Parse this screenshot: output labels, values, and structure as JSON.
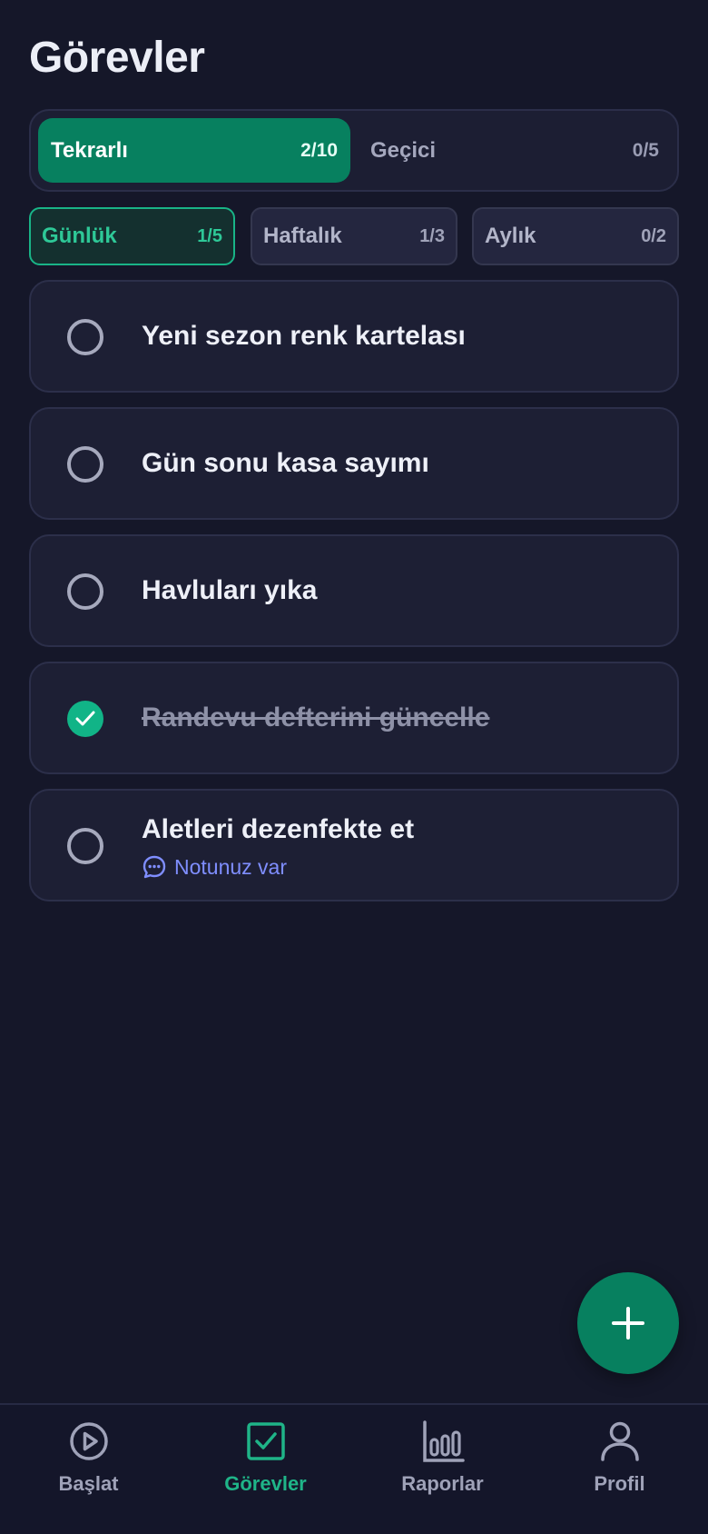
{
  "header": {
    "title": "Görevler"
  },
  "segment": {
    "active": {
      "label": "Tekrarlı",
      "count": "2/10"
    },
    "inactive": {
      "label": "Geçici",
      "count": "0/5"
    }
  },
  "periods": [
    {
      "label": "Günlük",
      "count": "1/5",
      "active": true
    },
    {
      "label": "Haftalık",
      "count": "1/3",
      "active": false
    },
    {
      "label": "Aylık",
      "count": "0/2",
      "active": false
    }
  ],
  "tasks": [
    {
      "title": "Yeni sezon renk kartelası",
      "done": false
    },
    {
      "title": "Gün sonu kasa sayımı",
      "done": false
    },
    {
      "title": "Havluları yıka",
      "done": false
    },
    {
      "title": "Randevu defterini güncelle",
      "done": true
    },
    {
      "title": "Aletleri dezenfekte et",
      "done": false,
      "note": "Notunuz var"
    }
  ],
  "fab": {
    "icon": "plus-icon"
  },
  "nav": [
    {
      "label": "Başlat",
      "icon": "play-circle-icon",
      "active": false
    },
    {
      "label": "Görevler",
      "icon": "checkbox-icon",
      "active": true
    },
    {
      "label": "Raporlar",
      "icon": "bar-chart-icon",
      "active": false
    },
    {
      "label": "Profil",
      "icon": "user-icon",
      "active": false
    }
  ],
  "colors": {
    "background": "#151729",
    "accent": "#07805f",
    "accent_light": "#1fb488",
    "note": "#7f8eff"
  }
}
